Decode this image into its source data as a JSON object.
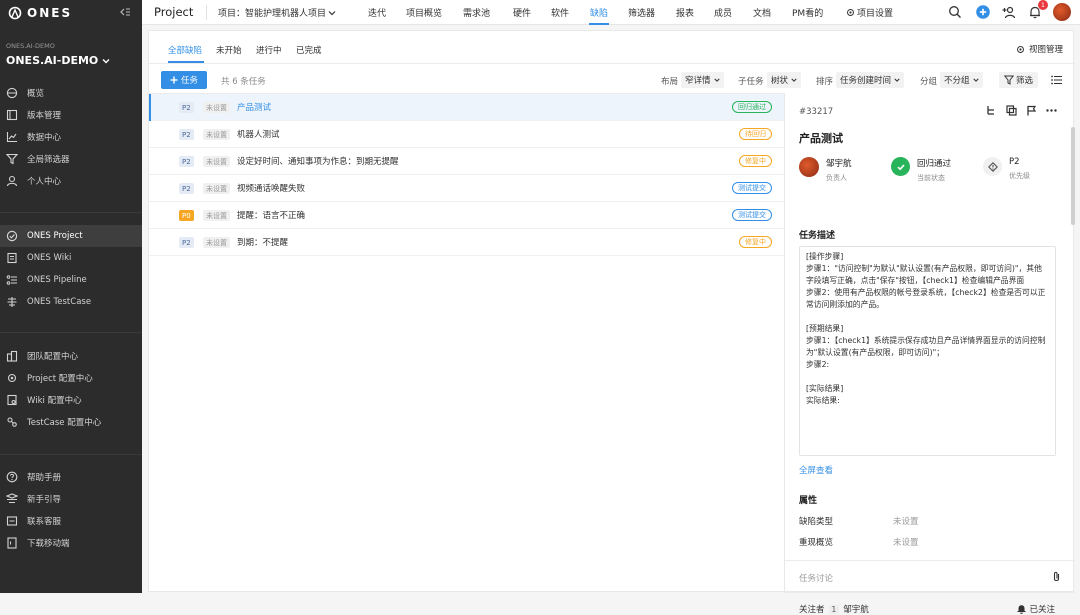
{
  "sidebar": {
    "logo": "ONES",
    "org_small": "ONES.AI-DEMO",
    "org_big": "ONES.AI-DEMO",
    "top_items": [
      {
        "label": "概览",
        "icon": "dashboard-icon"
      },
      {
        "label": "版本管理",
        "icon": "version-icon"
      },
      {
        "label": "数据中心",
        "icon": "chart-icon"
      },
      {
        "label": "全局筛选器",
        "icon": "filter-icon"
      },
      {
        "label": "个人中心",
        "icon": "user-icon"
      }
    ],
    "product_items": [
      {
        "label": "ONES Project",
        "icon": "project-icon",
        "active": true
      },
      {
        "label": "ONES Wiki",
        "icon": "wiki-icon"
      },
      {
        "label": "ONES Pipeline",
        "icon": "pipeline-icon"
      },
      {
        "label": "ONES TestCase",
        "icon": "testcase-icon"
      }
    ],
    "config_items": [
      {
        "label": "团队配置中心",
        "icon": "team-config-icon"
      },
      {
        "label": "Project 配置中心",
        "icon": "project-config-icon"
      },
      {
        "label": "Wiki 配置中心",
        "icon": "wiki-config-icon"
      },
      {
        "label": "TestCase 配置中心",
        "icon": "testcase-config-icon"
      }
    ],
    "help_items": [
      {
        "label": "帮助手册",
        "icon": "help-icon"
      },
      {
        "label": "新手引导",
        "icon": "guide-icon"
      },
      {
        "label": "联系客服",
        "icon": "service-icon"
      },
      {
        "label": "下载移动端",
        "icon": "mobile-icon"
      }
    ]
  },
  "topbar": {
    "app_title": "Project",
    "project_label": "项目：智能护理机器人项目",
    "nav": [
      "迭代",
      "项目概览",
      "需求池",
      "硬件",
      "软件",
      "缺陷",
      "筛选器",
      "报表",
      "成员",
      "文档",
      "PM看的",
      "项目设置"
    ],
    "active_nav": "缺陷",
    "notification_count": "1"
  },
  "subtabs": [
    "全部缺陷",
    "未开始",
    "进行中",
    "已完成"
  ],
  "view_manage": "视图管理",
  "toolbar": {
    "add_label": "任务",
    "count_text": "共 6 条任务",
    "layout_label": "布局",
    "layout_value": "窄详情",
    "subtask_label": "子任务",
    "subtask_value": "树状",
    "sort_label": "排序",
    "sort_value": "任务创建时间",
    "group_label": "分组",
    "group_value": "不分组",
    "filter_label": "筛选"
  },
  "rows": [
    {
      "priority": "P2",
      "type": "未设置",
      "title": "产品测试",
      "status": "回归通过",
      "status_color": "#28b45a"
    },
    {
      "priority": "P2",
      "type": "未设置",
      "title": "机器人测试",
      "status": "待回归",
      "status_color": "#f5a623"
    },
    {
      "priority": "P2",
      "type": "未设置",
      "title": "设定好时间、通知事项为作息：到期无提醒",
      "status": "修复中",
      "status_color": "#f5a623"
    },
    {
      "priority": "P2",
      "type": "未设置",
      "title": "视频通话唤醒失败",
      "status": "测试提交",
      "status_color": "#338fe5"
    },
    {
      "priority": "P0",
      "type": "未设置",
      "title": "提醒：语言不正确",
      "status": "测试提交",
      "status_color": "#338fe5"
    },
    {
      "priority": "P2",
      "type": "未设置",
      "title": "到期：不提醒",
      "status": "修复中",
      "status_color": "#f5a623"
    }
  ],
  "detail": {
    "id": "#33217",
    "title": "产品测试",
    "assignee": "邹宇航",
    "assignee_label": "负责人",
    "state": "回归通过",
    "state_label": "当前状态",
    "priority": "P2",
    "priority_label": "优先级",
    "desc_title": "任务描述",
    "desc_lines": [
      "[操作步骤]",
      "步骤1：\"访问控制\"为默认\"默认设置(有产品权限，即可访问)\"，其他字段填写正确，点击\"保存\"按钮，【check1】检查编辑产品界面",
      "步骤2：使用有产品权限的帐号登录系统，【check2】检查是否可以正常访问刚添加的产品。",
      "",
      "[预期结果]",
      "步骤1：【check1】系统提示保存成功且产品详情界面显示的访问控制为\"默认设置(有产品权限，即可访问)\"；",
      "步骤2:",
      "",
      "[实际结果]",
      "实际结果:"
    ],
    "full_view": "全屏查看",
    "attr_title": "属性",
    "attrs": [
      {
        "label": "缺陷类型",
        "value": "未设置"
      },
      {
        "label": "重现概览",
        "value": "未设置"
      }
    ],
    "discussion": "任务讨论",
    "follow_label": "关注者",
    "follow_count": "1",
    "follower": "邹宇航",
    "followed": "已关注"
  }
}
